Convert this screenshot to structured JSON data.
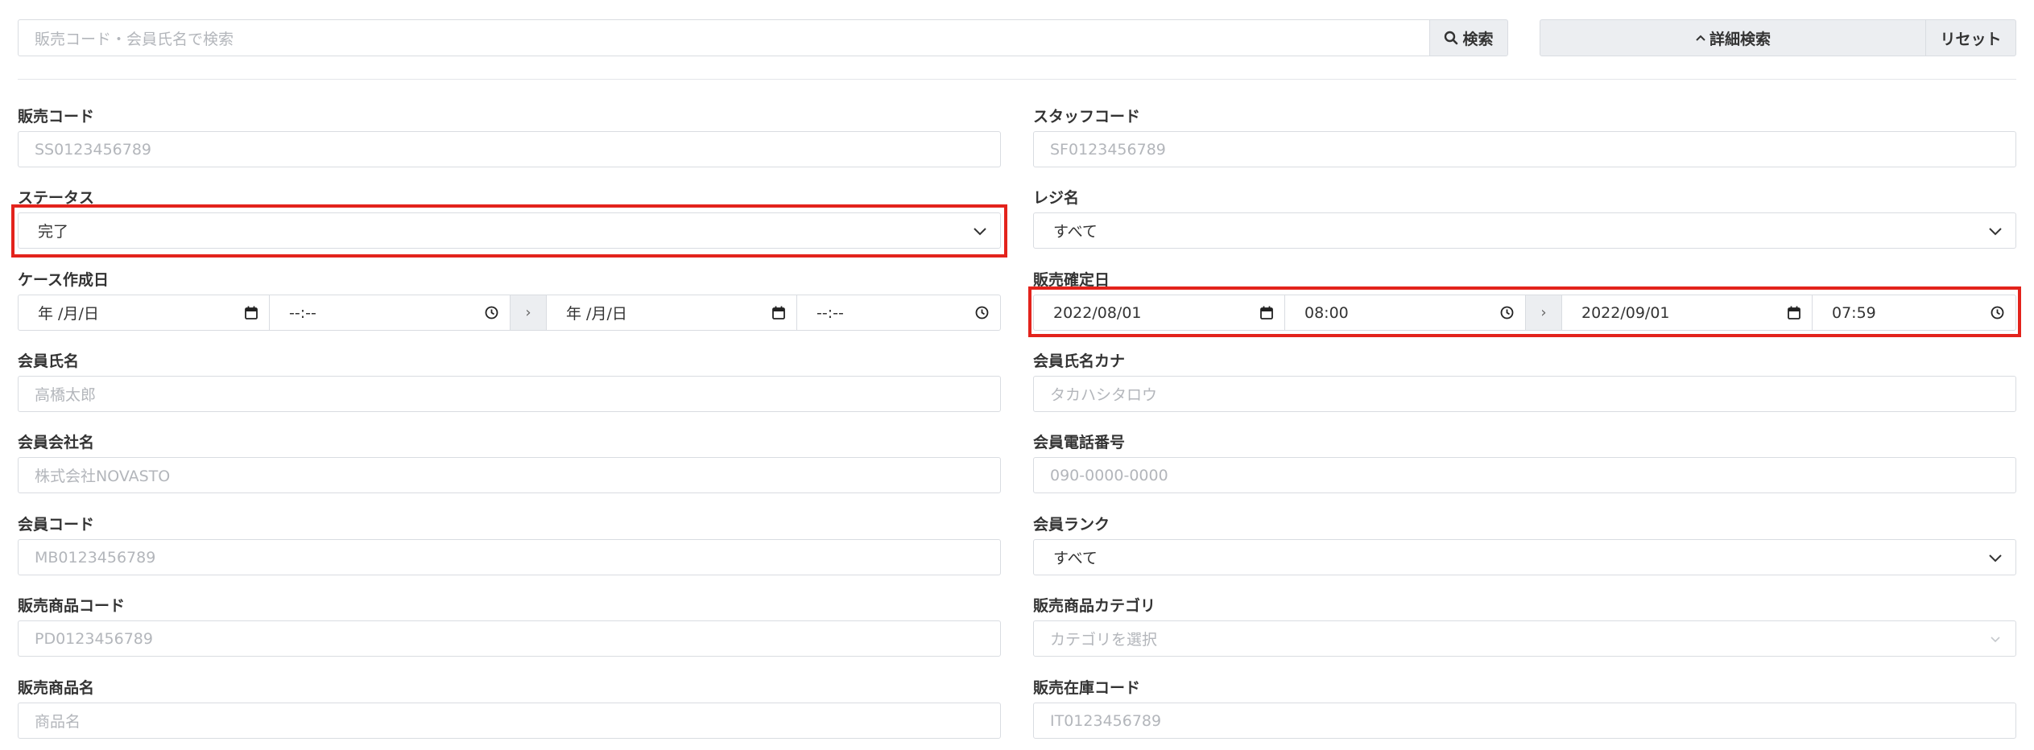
{
  "top": {
    "search_placeholder": "販売コード・会員氏名で検索",
    "search_button": "検索",
    "advanced_button": "詳細検索",
    "reset_button": "リセット"
  },
  "left": {
    "sales_code": {
      "label": "販売コード",
      "placeholder": "SS0123456789"
    },
    "status": {
      "label": "ステータス",
      "value": "完了"
    },
    "case_date": {
      "label": "ケース作成日",
      "from_date": "年 /月/日",
      "from_time": "--:--",
      "sep": "›",
      "to_date": "年 /月/日",
      "to_time": "--:--"
    },
    "member_name": {
      "label": "会員氏名",
      "placeholder": "高橋太郎"
    },
    "member_company": {
      "label": "会員会社名",
      "placeholder": "株式会社NOVASTO"
    },
    "member_code": {
      "label": "会員コード",
      "placeholder": "MB0123456789"
    },
    "product_code": {
      "label": "販売商品コード",
      "placeholder": "PD0123456789"
    },
    "product_name": {
      "label": "販売商品名",
      "placeholder": "商品名"
    }
  },
  "right": {
    "staff_code": {
      "label": "スタッフコード",
      "placeholder": "SF0123456789"
    },
    "register": {
      "label": "レジ名",
      "value": "すべて"
    },
    "confirm_date": {
      "label": "販売確定日",
      "from_date": "2022/08/01",
      "from_time": "08:00",
      "sep": "›",
      "to_date": "2022/09/01",
      "to_time": "07:59"
    },
    "member_kana": {
      "label": "会員氏名カナ",
      "placeholder": "タカハシタロウ"
    },
    "member_phone": {
      "label": "会員電話番号",
      "placeholder": "090-0000-0000"
    },
    "member_rank": {
      "label": "会員ランク",
      "value": "すべて"
    },
    "product_category": {
      "label": "販売商品カテゴリ",
      "placeholder": "カテゴリを選択"
    },
    "stock_code": {
      "label": "販売在庫コード",
      "placeholder": "IT0123456789"
    }
  },
  "colors": {
    "highlight": "#e3231c",
    "border": "#d9dce1",
    "button_bg": "#eceef1"
  }
}
